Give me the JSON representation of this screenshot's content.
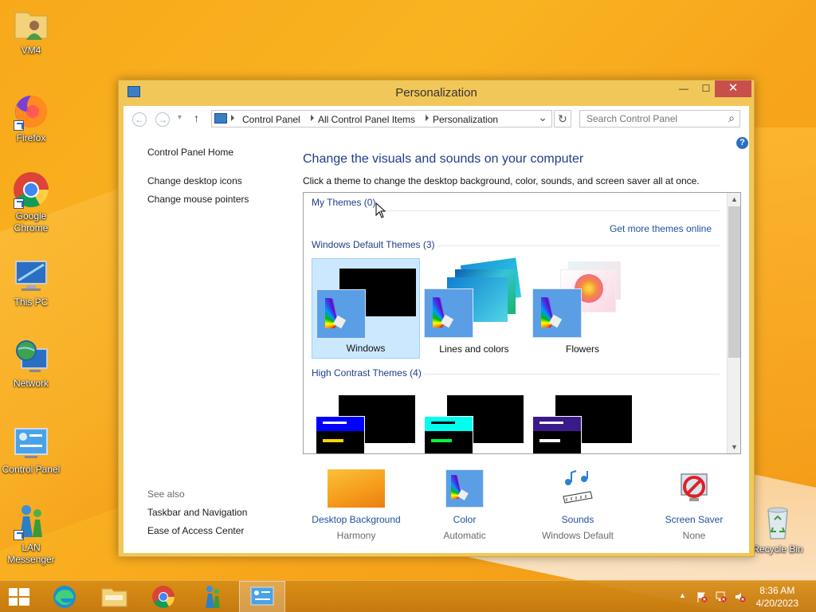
{
  "desktop": {
    "icons": [
      {
        "label": "VM4",
        "icon": "user-folder-icon"
      },
      {
        "label": "Firefox",
        "icon": "firefox-icon"
      },
      {
        "label": "Google Chrome",
        "icon": "chrome-icon"
      },
      {
        "label": "This PC",
        "icon": "this-pc-icon"
      },
      {
        "label": "Network",
        "icon": "network-icon"
      },
      {
        "label": "Control Panel",
        "icon": "control-panel-icon"
      },
      {
        "label": "LAN Messenger",
        "icon": "lan-messenger-icon"
      },
      {
        "label": "Recycle Bin",
        "icon": "recycle-bin-icon"
      }
    ]
  },
  "window": {
    "title": "Personalization",
    "minimize": "—",
    "maximize": "☐",
    "close": "✕"
  },
  "address": {
    "back": "←",
    "forward": "→",
    "recent": "▾",
    "up": "↑",
    "crumbs": [
      "Control Panel",
      "All Control Panel Items",
      "Personalization"
    ],
    "dropdown": "⌄",
    "refresh": "↻",
    "search_placeholder": "Search Control Panel",
    "search_glyph": "⌕"
  },
  "help_glyph": "?",
  "sidebar": {
    "home": "Control Panel Home",
    "links": [
      "Change desktop icons",
      "Change mouse pointers"
    ],
    "see_also_label": "See also",
    "see_also": [
      "Taskbar and Navigation",
      "Ease of Access Center"
    ]
  },
  "main": {
    "heading": "Change the visuals and sounds on your computer",
    "subtext": "Click a theme to change the desktop background, color, sounds, and screen saver all at once.",
    "my_themes": "My Themes (0)",
    "get_more": "Get more themes online",
    "default_themes": "Windows Default Themes (3)",
    "themes": [
      "Windows",
      "Lines and colors",
      "Flowers"
    ],
    "high_contrast": "High Contrast Themes (4)",
    "scroll_up": "▲",
    "scroll_down": "▼"
  },
  "bottom": [
    {
      "name": "Desktop Background",
      "value": "Harmony"
    },
    {
      "name": "Color",
      "value": "Automatic"
    },
    {
      "name": "Sounds",
      "value": "Windows Default"
    },
    {
      "name": "Screen Saver",
      "value": "None"
    }
  ],
  "tray": {
    "overflow": "▲",
    "time": "8:36 AM",
    "date": "4/20/2023"
  },
  "colors": {
    "accent_blue": "#1e3d8a",
    "close_red": "#c7504b",
    "selection": "#cce8ff"
  }
}
